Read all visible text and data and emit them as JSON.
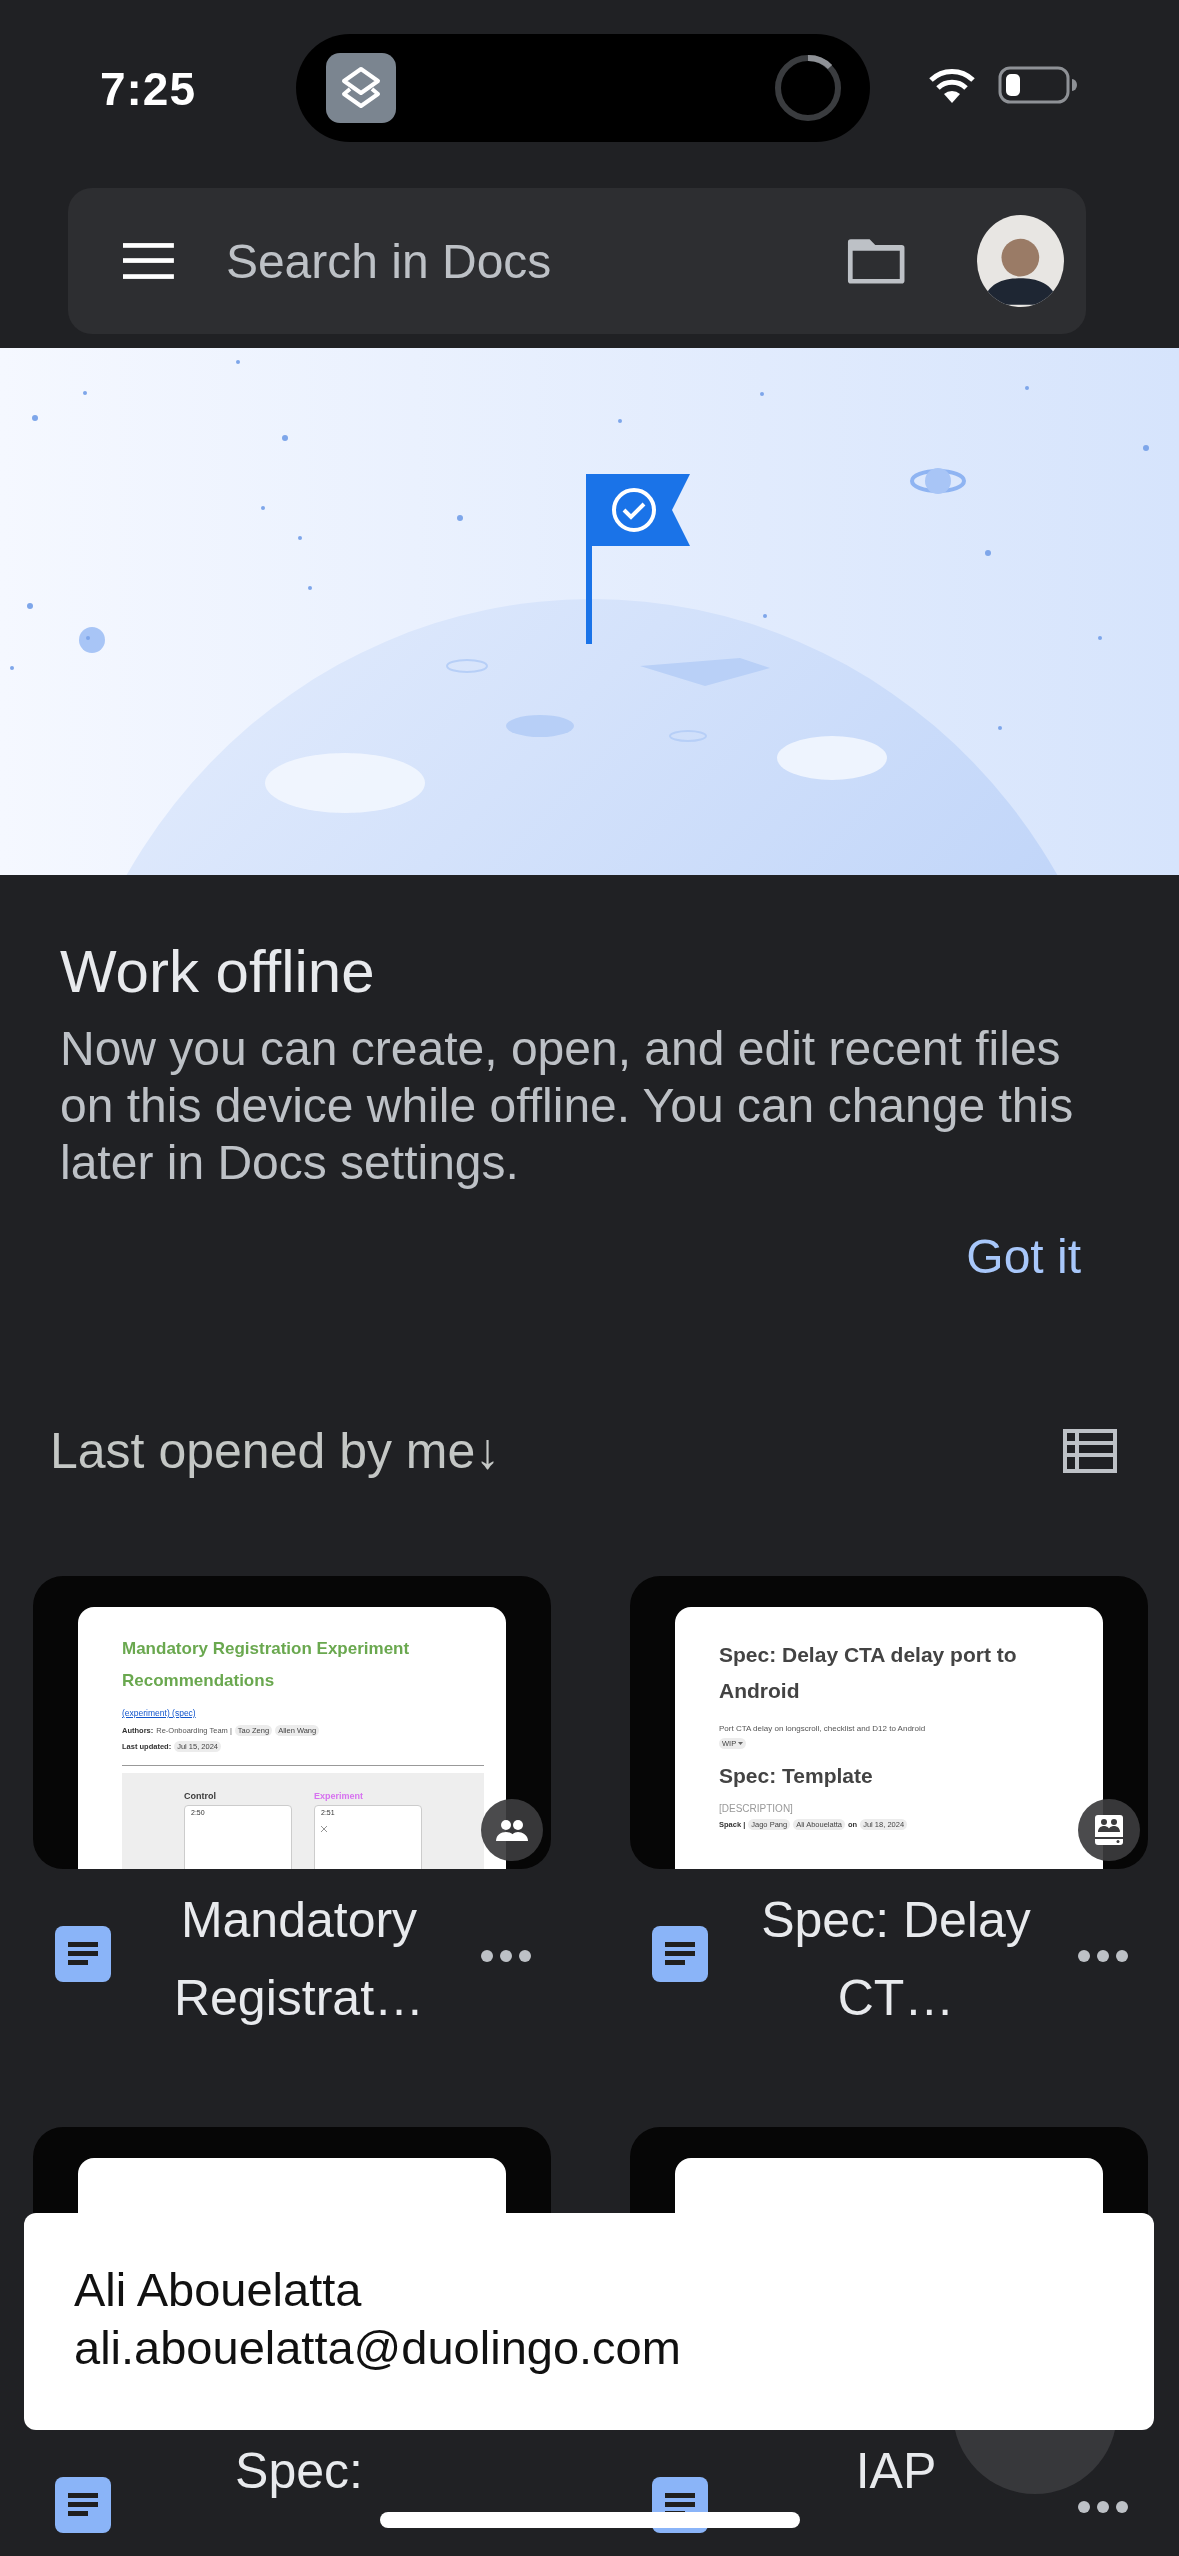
{
  "status_bar": {
    "time": "7:25"
  },
  "search": {
    "placeholder": "Search in Docs"
  },
  "banner": {
    "title": "Work offline",
    "body": "Now you can create, open, and edit recent files on this device while offline. You can change this later in Docs settings.",
    "action": "Got it"
  },
  "sort": {
    "label": "Last opened by me",
    "direction": "↓"
  },
  "files": [
    {
      "title": "Mandatory Registrat…",
      "kind": "shared",
      "more_menu": true,
      "thumbnail": [
        {
          "kind": "title",
          "text": "Mandatory Registration Experiment Recommendations",
          "color": "#6aa84f"
        },
        {
          "kind": "link",
          "text": "(experiment) (spec)"
        },
        {
          "kind": "meta",
          "parts": [
            {
              "kind": "label",
              "text": "Authors:"
            },
            {
              "kind": "plain",
              "text": "Re-Onboarding Team |"
            },
            {
              "kind": "chip",
              "text": "Tao Zeng"
            },
            {
              "kind": "chip",
              "text": "Allen Wang"
            }
          ]
        },
        {
          "kind": "meta",
          "parts": [
            {
              "kind": "label",
              "text": "Last updated:"
            },
            {
              "kind": "chip",
              "text": "Jul 15, 2024"
            }
          ]
        },
        {
          "kind": "figure",
          "panels": [
            {
              "label": "Control",
              "time": "2:50",
              "color": "#3c3c3c",
              "close": false
            },
            {
              "label": "Experiment",
              "time": "2:51",
              "color": "#d772f0",
              "close": true
            }
          ]
        }
      ]
    },
    {
      "title": "Spec: Delay CT…",
      "kind": "shared_drive",
      "more_menu": true,
      "thumbnail": [
        {
          "kind": "heading",
          "text": "Spec: Delay CTA delay port to Android"
        },
        {
          "kind": "text",
          "text": "Port CTA delay on longscroll, checklist and D12 to Android"
        },
        {
          "kind": "meta",
          "parts": [
            {
              "kind": "dropchip",
              "text": "WIP"
            }
          ]
        },
        {
          "kind": "heading",
          "text": "Spec: Template"
        },
        {
          "kind": "hint",
          "text": "[DESCRIPTION]"
        },
        {
          "kind": "meta",
          "parts": [
            {
              "kind": "label",
              "text": "Spack |"
            },
            {
              "kind": "chip",
              "text": "Jago Pang"
            },
            {
              "kind": "chip",
              "text": "Ali Abouelatta"
            },
            {
              "kind": "label",
              "text": "on"
            },
            {
              "kind": "chip",
              "text": "Jul 18, 2024"
            }
          ]
        }
      ]
    },
    {
      "title": "Spec:",
      "more_menu": false
    },
    {
      "title": "IAP",
      "more_menu": true
    }
  ],
  "account_toast": {
    "name": "Ali Abouelatta",
    "email": "ali.abouelatta@duolingo.com"
  }
}
